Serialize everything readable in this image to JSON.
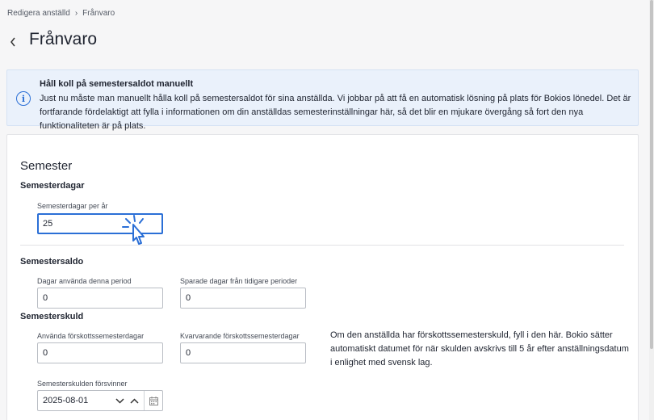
{
  "breadcrumb": {
    "parent": "Redigera anställd",
    "separator": "›",
    "current": "Frånvaro"
  },
  "page": {
    "title": "Frånvaro",
    "back_icon": "chevron-left-icon"
  },
  "banner": {
    "icon": "info-icon",
    "icon_glyph": "i",
    "title": "Håll koll på semestersaldot manuellt",
    "text": "Just nu måste man manuellt hålla koll på semestersaldot för sina anställda. Vi jobbar på att få en automatisk lösning på plats för Bokios lönedel. Det är fortfarande fördelaktigt att fylla i informationen om din anställdas semesterinställningar här, så det blir en mjukare övergång så fort den nya funktionaliteten är på plats."
  },
  "vacation": {
    "title": "Semester",
    "days": {
      "heading": "Semesterdagar",
      "per_year_label": "Semesterdagar per år",
      "per_year_value": "25"
    },
    "balance": {
      "heading": "Semestersaldo",
      "used_label": "Dagar använda denna period",
      "used_value": "0",
      "saved_label": "Sparade dagar från tidigare perioder",
      "saved_value": "0"
    },
    "debt": {
      "heading": "Semesterskuld",
      "advance_used_label": "Använda förskottssemesterdagar",
      "advance_used_value": "0",
      "advance_remaining_label": "Kvarvarande förskottssemesterdagar",
      "advance_remaining_value": "0",
      "note": "Om den anställda har förskottssemesterskuld, fyll i den här. Bokio sätter automatiskt datumet för när skulden avskrivs till 5 år efter anställningsdatum i enlighet med svensk lag.",
      "expires_label": "Semesterskulden försvinner",
      "expires_value": "2025-08-01"
    }
  },
  "colors": {
    "accent": "#2b6fd6",
    "banner_bg": "#eaf1fb",
    "page_bg": "#f6f6f7"
  }
}
